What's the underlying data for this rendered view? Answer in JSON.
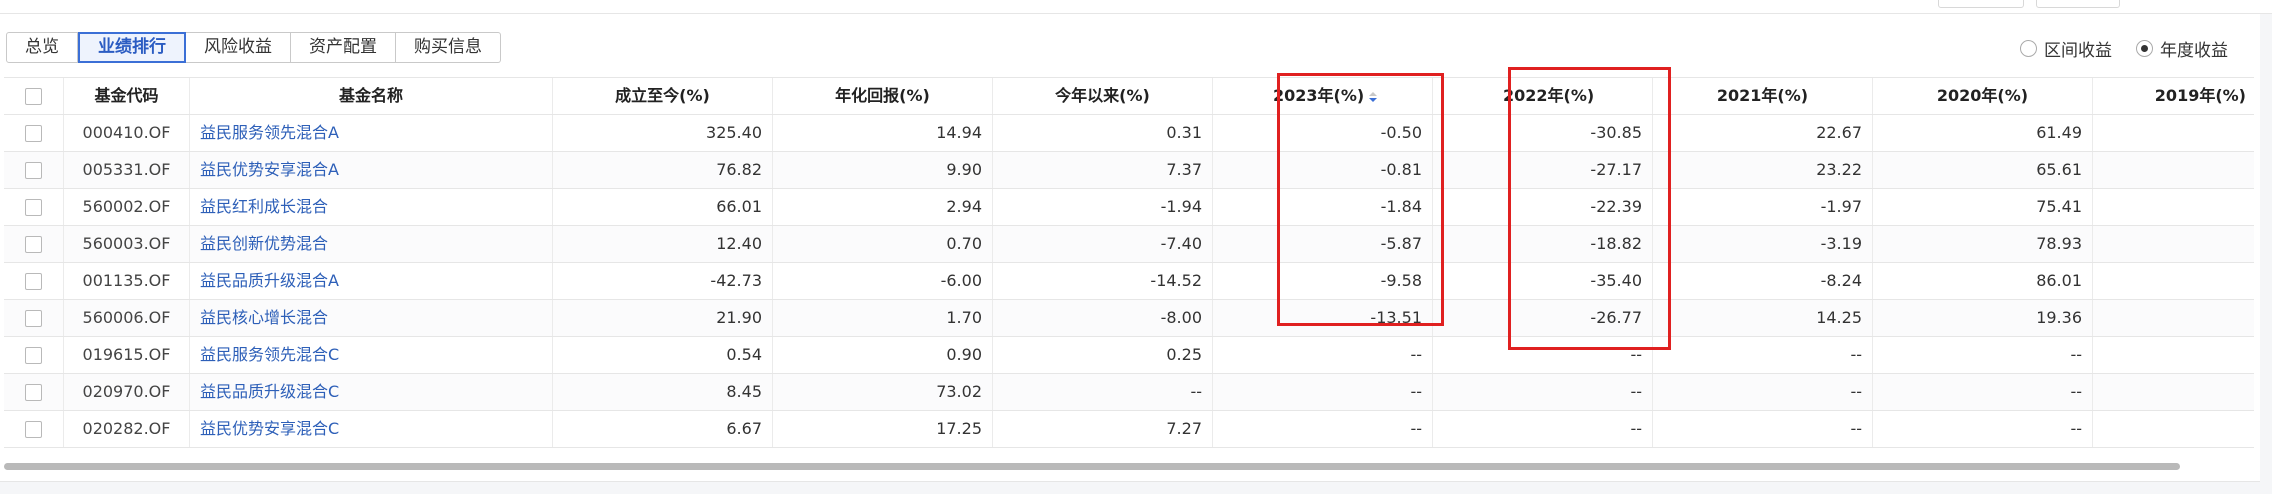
{
  "tabs": [
    {
      "label": "总览",
      "active": false
    },
    {
      "label": "业绩排行",
      "active": true
    },
    {
      "label": "风险收益",
      "active": false
    },
    {
      "label": "资产配置",
      "active": false
    },
    {
      "label": "购买信息",
      "active": false
    }
  ],
  "radios": [
    {
      "label": "区间收益",
      "selected": false
    },
    {
      "label": "年度收益",
      "selected": true
    }
  ],
  "table": {
    "headers": [
      "基金代码",
      "基金名称",
      "成立至今(%)",
      "年化回报(%)",
      "今年以来(%)",
      "2023年(%)",
      "2022年(%)",
      "2021年(%)",
      "2020年(%)",
      "2019年(%)"
    ],
    "sorted_column": "2023年(%)",
    "rows": [
      [
        "000410.OF",
        "益民服务领先混合A",
        "325.40",
        "14.94",
        "0.31",
        "-0.50",
        "-30.85",
        "22.67",
        "61.49",
        ""
      ],
      [
        "005331.OF",
        "益民优势安享混合A",
        "76.82",
        "9.90",
        "7.37",
        "-0.81",
        "-27.17",
        "23.22",
        "65.61",
        ""
      ],
      [
        "560002.OF",
        "益民红利成长混合",
        "66.01",
        "2.94",
        "-1.94",
        "-1.84",
        "-22.39",
        "-1.97",
        "75.41",
        ""
      ],
      [
        "560003.OF",
        "益民创新优势混合",
        "12.40",
        "0.70",
        "-7.40",
        "-5.87",
        "-18.82",
        "-3.19",
        "78.93",
        ""
      ],
      [
        "001135.OF",
        "益民品质升级混合A",
        "-42.73",
        "-6.00",
        "-14.52",
        "-9.58",
        "-35.40",
        "-8.24",
        "86.01",
        ""
      ],
      [
        "560006.OF",
        "益民核心增长混合",
        "21.90",
        "1.70",
        "-8.00",
        "-13.51",
        "-26.77",
        "14.25",
        "19.36",
        ""
      ],
      [
        "019615.OF",
        "益民服务领先混合C",
        "0.54",
        "0.90",
        "0.25",
        "--",
        "--",
        "--",
        "--",
        ""
      ],
      [
        "020970.OF",
        "益民品质升级混合C",
        "8.45",
        "73.02",
        "--",
        "--",
        "--",
        "--",
        "--",
        ""
      ],
      [
        "020282.OF",
        "益民优势安享混合C",
        "6.67",
        "17.25",
        "7.27",
        "--",
        "--",
        "--",
        "--",
        ""
      ]
    ]
  },
  "colors": {
    "accent": "#3b6fd6",
    "link": "#2d5fb8",
    "highlight_box": "#e02020"
  }
}
